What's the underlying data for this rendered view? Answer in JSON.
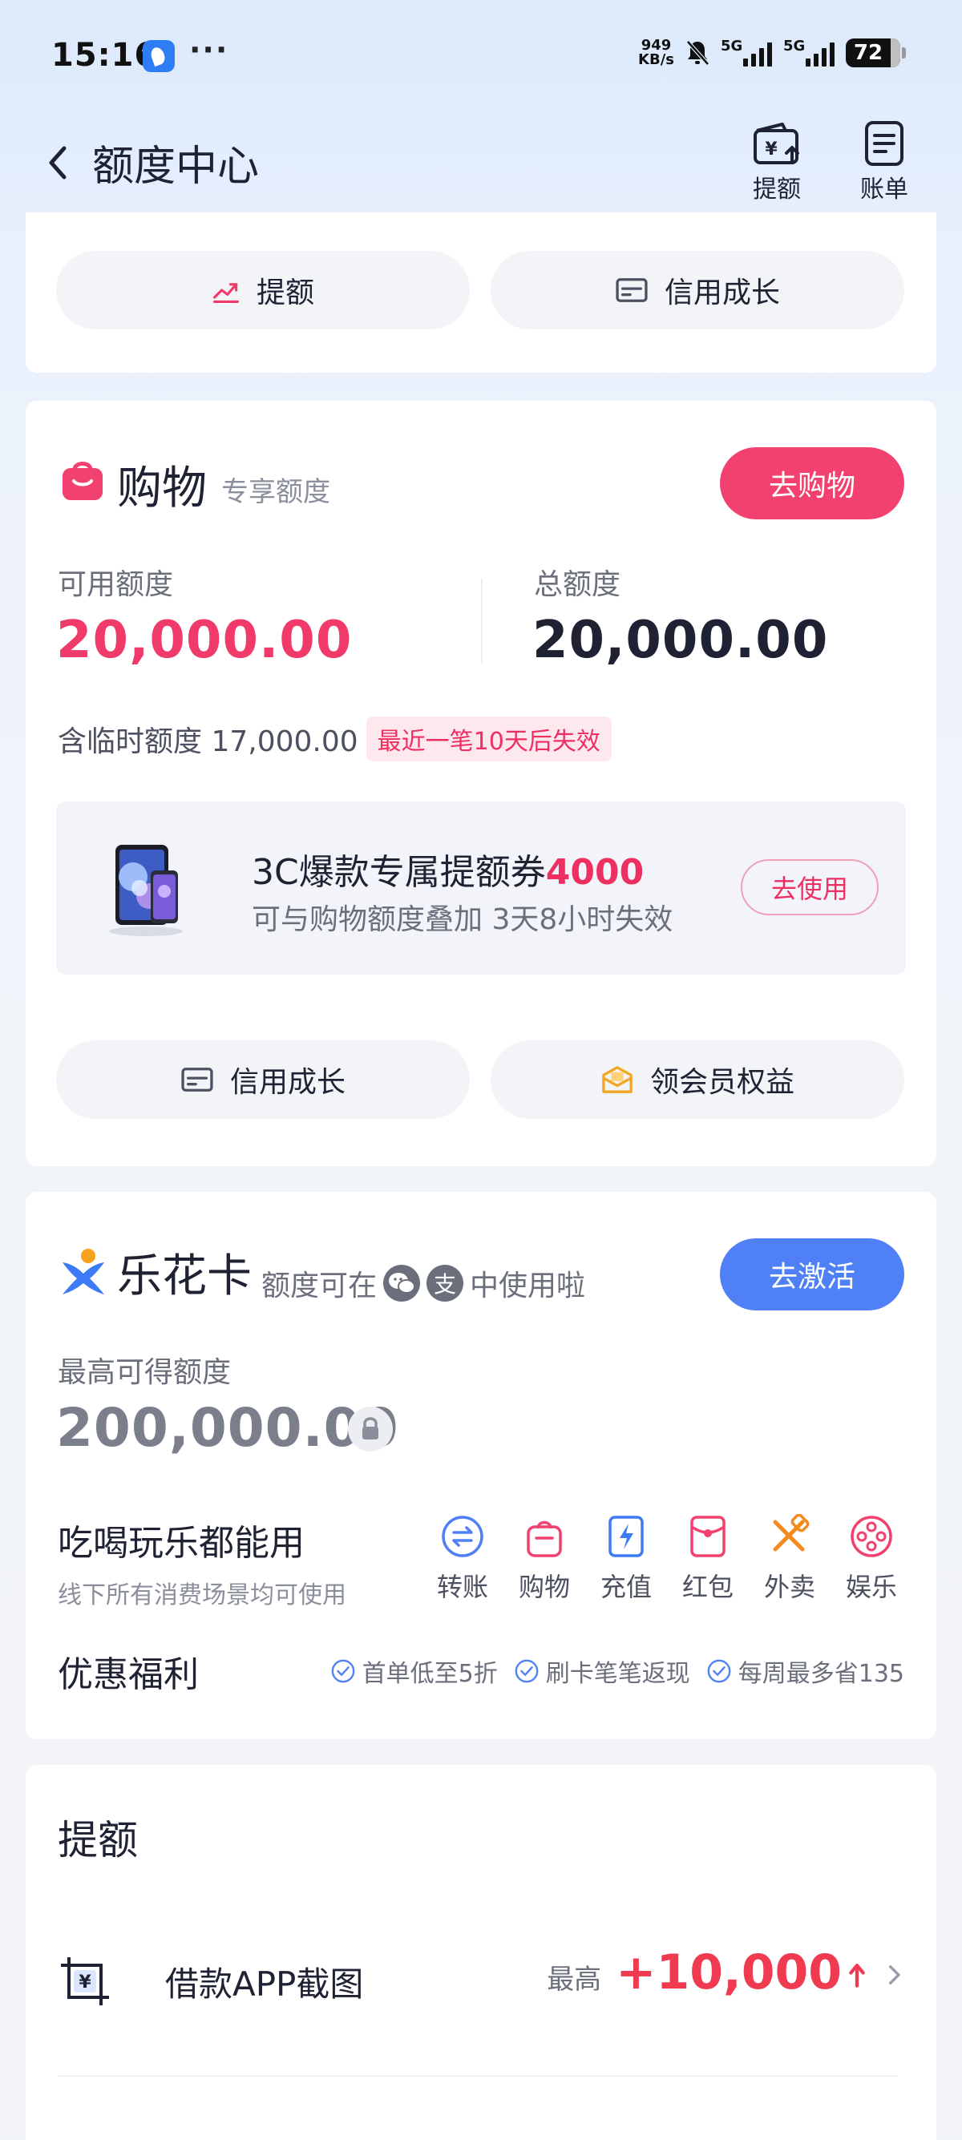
{
  "status": {
    "time": "15:16",
    "dots": "···",
    "speed_top": "949",
    "speed_unit": "KB/s",
    "network1": "5G",
    "network2": "5G",
    "battery": "72"
  },
  "header": {
    "title": "额度中心",
    "raise_label": "提额",
    "bill_label": "账单"
  },
  "top_card": {
    "left_button": "提额",
    "right_button": "信用成长"
  },
  "shopping": {
    "title": "购物",
    "subtitle": "专享额度",
    "cta": "去购物",
    "available_label": "可用额度",
    "available_value": "20,000.00",
    "total_label": "总额度",
    "total_value": "20,000.00",
    "temp_text": "含临时额度 17,000.00",
    "temp_badge": "最近一笔10天后失效",
    "coupon_title": "3C爆款专属提额券",
    "coupon_amount": "4000",
    "coupon_sub": "可与购物额度叠加 3天8小时失效",
    "coupon_button": "去使用",
    "btn_credit": "信用成长",
    "btn_member": "领会员权益"
  },
  "lehua": {
    "title": "乐花卡",
    "sub_prefix": "额度可在",
    "sub_suffix": "中使用啦",
    "alipay_char": "支",
    "cta": "去激活",
    "max_label": "最高可得额度",
    "max_value": "200,000.00",
    "eat_title": "吃喝玩乐都能用",
    "eat_sub": "线下所有消费场景均可使用",
    "services": [
      "转账",
      "购物",
      "充值",
      "红包",
      "外卖",
      "娱乐"
    ],
    "perks_title": "优惠福利",
    "perks": [
      "首单低至5折",
      "刷卡笔笔返现",
      "每周最多省135"
    ]
  },
  "raise": {
    "title": "提额",
    "item_label": "借款APP截图",
    "item_prefix": "最高",
    "item_value": "+10,000"
  },
  "colors": {
    "pink": "#ef3a6a",
    "blue": "#4f80f6",
    "text": "#1f2233",
    "gray": "#6b6f7c"
  }
}
